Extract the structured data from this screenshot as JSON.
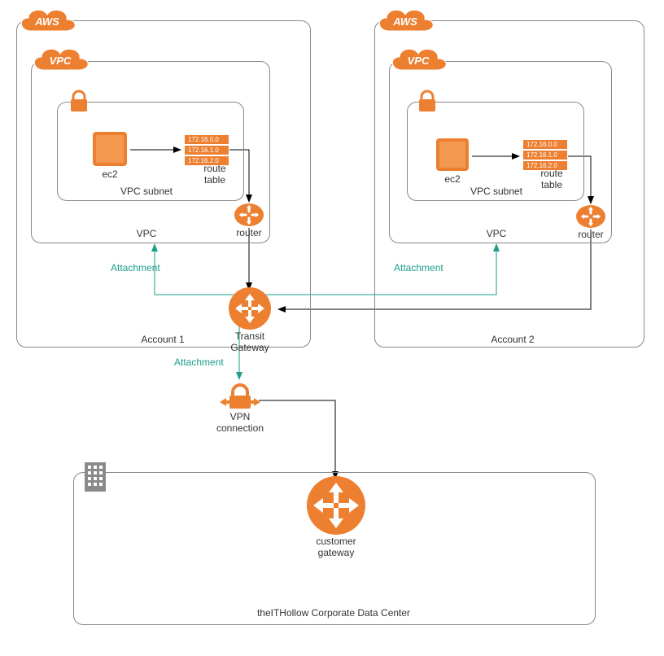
{
  "badges": {
    "aws": "AWS",
    "vpc": "VPC"
  },
  "account1": {
    "label": "Account 1",
    "vpc_label": "VPC",
    "subnet_label": "VPC subnet",
    "ec2_label": "ec2",
    "router_label": "router",
    "route_table_label": "route\ntable",
    "routes": [
      "172.16.0.0",
      "172.16.1.0",
      "172.16.2.0"
    ]
  },
  "account2": {
    "label": "Account 2",
    "vpc_label": "VPC",
    "subnet_label": "VPC subnet",
    "ec2_label": "ec2",
    "router_label": "router",
    "route_table_label": "route\ntable",
    "routes": [
      "172.16.0.0",
      "172.16.1.0",
      "172.16.2.0"
    ]
  },
  "tgw": {
    "label": "Transit\nGateway"
  },
  "vpn": {
    "label": "VPN\nconnection"
  },
  "cgw": {
    "label": "customer\ngateway"
  },
  "datacenter": {
    "label": "theITHollow Corporate Data Center"
  },
  "attachments": {
    "a1": "Attachment",
    "a2": "Attachment",
    "a3": "Attachment"
  }
}
